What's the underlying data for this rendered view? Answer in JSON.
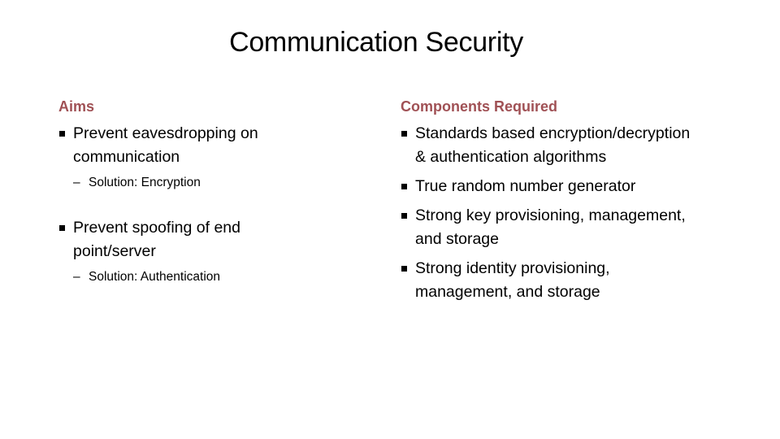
{
  "title": "Communication Security",
  "aims": {
    "heading": "Aims",
    "items": [
      {
        "text": "Prevent eavesdropping on communication",
        "sub": "Solution: Encryption"
      },
      {
        "text": "Prevent spoofing of end point/server",
        "sub": "Solution: Authentication"
      }
    ]
  },
  "components": {
    "heading": "Components Required",
    "items": [
      "Standards based encryption/decryption & authentication algorithms",
      "True random number generator",
      "Strong key provisioning, management, and storage",
      "Strong identity provisioning, management, and storage"
    ]
  },
  "sub_marker": "–",
  "colors": {
    "heading": "#a05155",
    "text": "#000000"
  }
}
